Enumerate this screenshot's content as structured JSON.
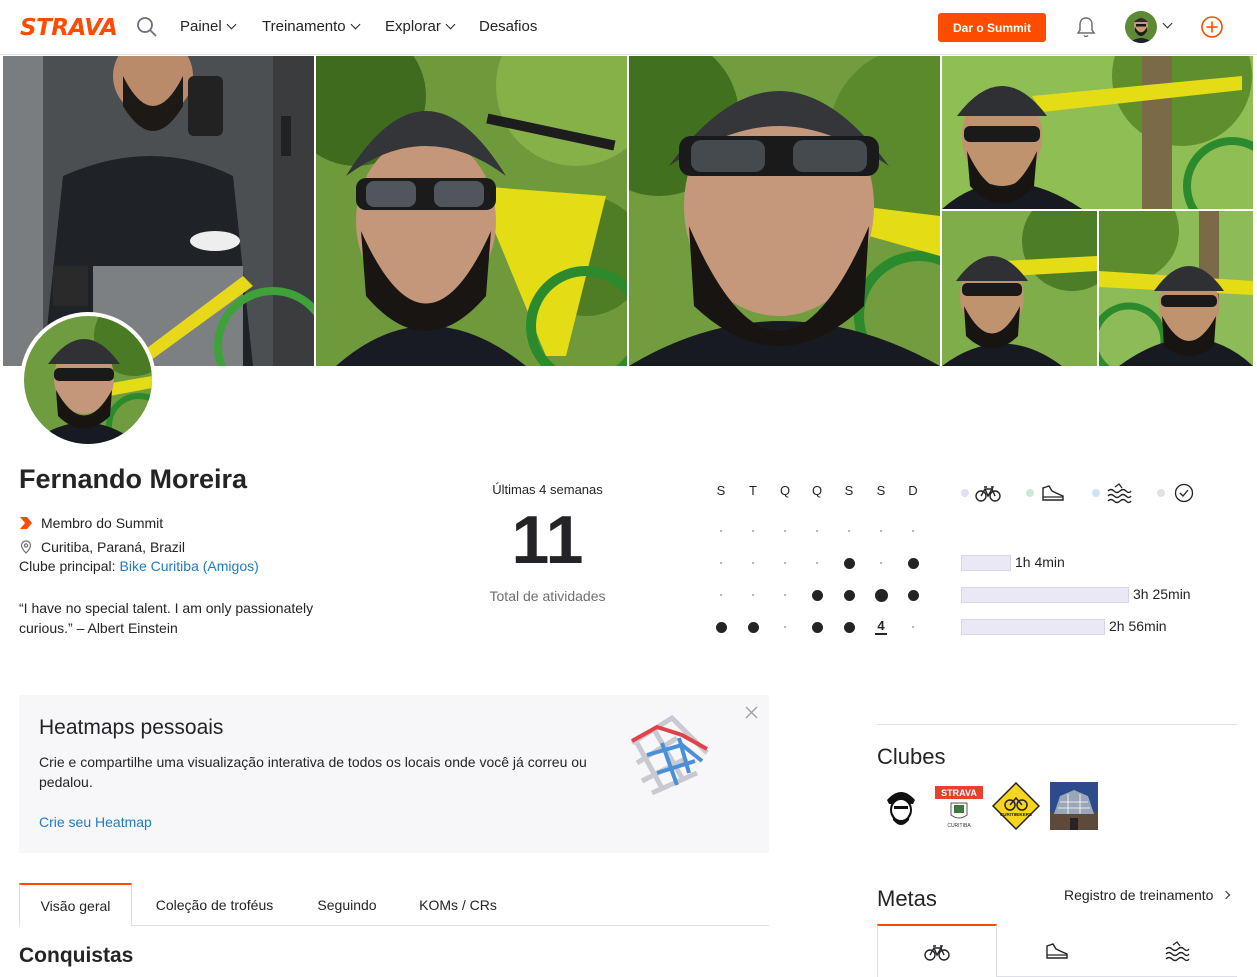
{
  "nav": {
    "logo": "STRAVA",
    "items": [
      "Painel",
      "Treinamento",
      "Explorar",
      "Desafios"
    ],
    "summit_button": "Dar o Summit"
  },
  "profile": {
    "name": "Fernando Moreira",
    "membership": "Membro do Summit",
    "location": "Curitiba, Paraná, Brazil",
    "club_label": "Clube principal:",
    "club_name": "Bike Curitiba (Amigos)",
    "quote": "“I have no special talent. I am only passionately curious.” – Albert Einstein"
  },
  "stats": {
    "period_label": "Últimas 4 semanas",
    "total": "11",
    "total_label": "Total de atividades",
    "days": [
      "S",
      "T",
      "Q",
      "Q",
      "S",
      "S",
      "D"
    ],
    "today": "4",
    "weeks": [
      {
        "dots": [
          0,
          0,
          0,
          0,
          0,
          0,
          0
        ],
        "time": ""
      },
      {
        "dots": [
          0,
          0,
          0,
          0,
          1,
          0,
          1
        ],
        "time": "1h 4min",
        "bar_fraction": 0.3
      },
      {
        "dots": [
          0,
          0,
          0,
          1,
          1,
          2,
          1
        ],
        "time": "3h 25min",
        "bar_fraction": 1.0
      },
      {
        "dots": [
          1,
          1,
          0,
          1,
          1,
          3,
          0
        ],
        "time": "2h 56min",
        "bar_fraction": 0.86
      }
    ],
    "sport_icons": [
      "bike-icon",
      "run-shoe-icon",
      "swim-icon",
      "check-circle-icon"
    ],
    "sport_dot_colors": [
      "#dfe0f0",
      "#cfe8d2",
      "#cde3f2",
      "#e1e1e6"
    ]
  },
  "heatmap_card": {
    "title": "Heatmaps pessoais",
    "description": "Crie e compartilhe uma visualização interativa de todos os locais onde você já correu ou pedalou.",
    "link": "Crie seu Heatmap"
  },
  "tabs": [
    "Visão geral",
    "Coleção de troféus",
    "Seguindo",
    "KOMs / CRs"
  ],
  "section_title": "Conquistas",
  "clubs": {
    "title": "Clubes",
    "logo_text_strava": "STRAVA",
    "logo_text_city": "CURITIBA",
    "logo_text_curitibikers": "CURITIBIKERS"
  },
  "metas": {
    "title": "Metas",
    "registro_link": "Registro de treinamento"
  },
  "colors": {
    "accent": "#fc4c02",
    "link": "#1e7bc6",
    "bar_fill": "#ebe8f5"
  }
}
